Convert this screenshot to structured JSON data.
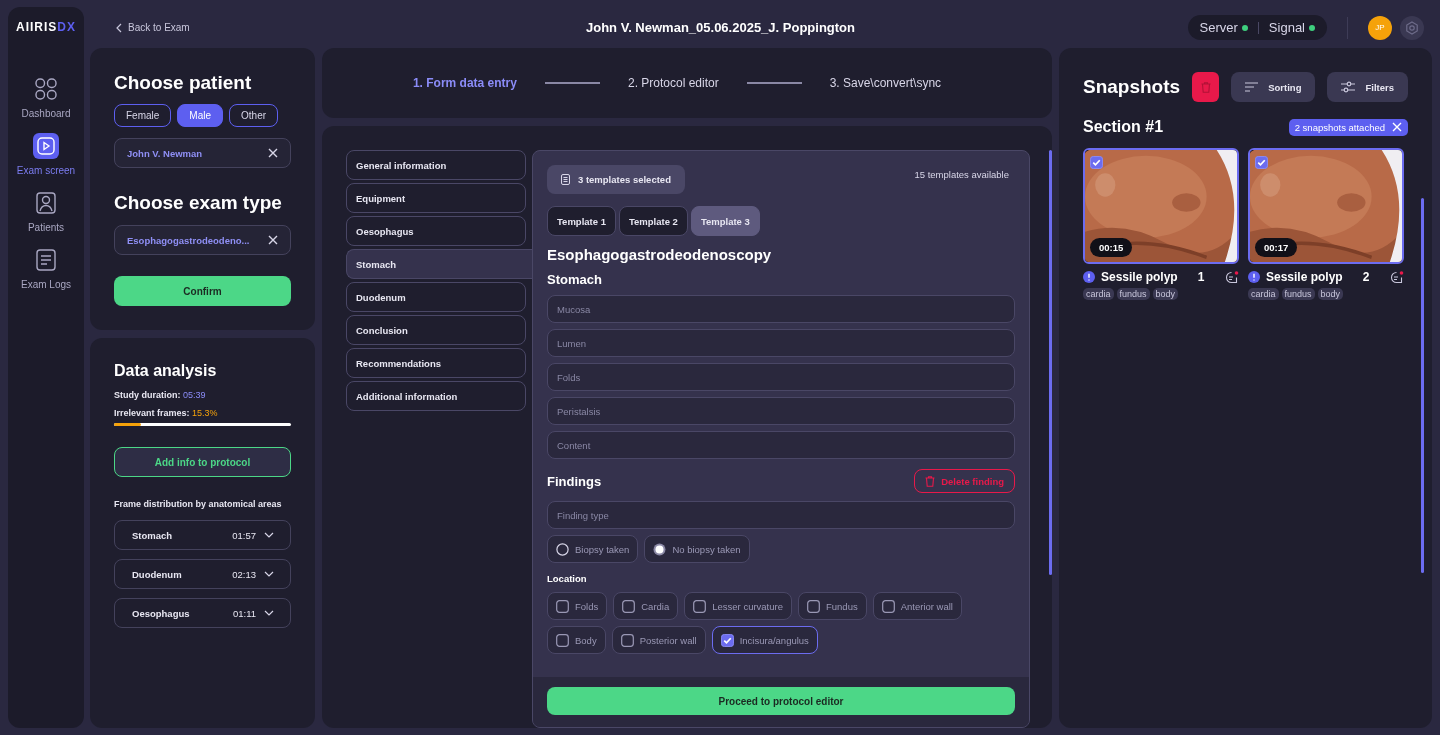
{
  "app": {
    "logo_primary": "AIIRIS",
    "logo_accent": "DX"
  },
  "nav": [
    {
      "label": "Dashboard",
      "selected": false
    },
    {
      "label": "Exam screen",
      "selected": true
    },
    {
      "label": "Patients",
      "selected": false
    },
    {
      "label": "Exam Logs",
      "selected": false
    }
  ],
  "header": {
    "back": "Back to Exam",
    "title": "John V. Newman_05.06.2025_J. Poppington",
    "status": [
      {
        "label": "Server",
        "online": true
      },
      {
        "label": "Signal",
        "online": true
      }
    ],
    "avatar": "JP"
  },
  "patient": {
    "title": "Choose patient",
    "genders": [
      {
        "label": "Female",
        "selected": false
      },
      {
        "label": "Male",
        "selected": true
      },
      {
        "label": "Other",
        "selected": false
      }
    ],
    "patient_value": "John V. Newman",
    "exam_title": "Choose exam type",
    "exam_value": "Esophagogastrodeodeno...",
    "confirm": "Confirm"
  },
  "analysis": {
    "title": "Data analysis",
    "duration_label": "Study duration:",
    "duration": "05:39",
    "irrelevant_label": "Irrelevant frames:",
    "irrelevant": "15.3%",
    "level": 0.153,
    "add_button": "Add info to protocol",
    "distribution_title": "Frame distribution by anatomical areas",
    "areas": [
      {
        "name": "Stomach",
        "time": "01:57",
        "expanded": false
      },
      {
        "name": "Duodenum",
        "time": "02:13",
        "expanded": false
      },
      {
        "name": "Oesophagus",
        "time": "01:11",
        "expanded": false
      }
    ]
  },
  "stepper": [
    {
      "label": "1. Form data entry",
      "selected": true
    },
    {
      "label": "2. Protocol editor",
      "selected": false
    },
    {
      "label": "3. Save\\convert\\sync",
      "selected": false
    }
  ],
  "form": {
    "sections": [
      {
        "label": "General information",
        "selected": false
      },
      {
        "label": "Equipment",
        "selected": false
      },
      {
        "label": "Oesophagus",
        "selected": false
      },
      {
        "label": "Stomach",
        "selected": true
      },
      {
        "label": "Duodenum",
        "selected": false
      },
      {
        "label": "Conclusion",
        "selected": false
      },
      {
        "label": "Recommendations",
        "selected": false
      },
      {
        "label": "Additional information",
        "selected": false
      }
    ],
    "templates_selected": "3 templates selected",
    "templates_available": "15 templates available",
    "template_tabs": [
      {
        "label": "Template 1",
        "selected": false
      },
      {
        "label": "Template 2",
        "selected": false
      },
      {
        "label": "Template 3",
        "selected": true
      }
    ],
    "heading": "Esophagogastrodeodenoscopy",
    "subheading": "Stomach",
    "fields": [
      {
        "placeholder": "Mucosa"
      },
      {
        "placeholder": "Lumen"
      },
      {
        "placeholder": "Folds"
      },
      {
        "placeholder": "Peristalsis"
      },
      {
        "placeholder": "Content"
      }
    ],
    "findings_title": "Findings",
    "delete_button": "Delete finding",
    "finding_type": {
      "placeholder": "Finding type"
    },
    "biopsy": [
      {
        "label": "Biopsy taken",
        "selected": false
      },
      {
        "label": "No biopsy taken",
        "selected": true
      }
    ],
    "location_title": "Location",
    "locations": [
      {
        "label": "Folds",
        "checked": false
      },
      {
        "label": "Cardia",
        "checked": false
      },
      {
        "label": "Lesser curvature",
        "checked": false
      },
      {
        "label": "Fundus",
        "checked": false
      },
      {
        "label": "Anterior wall",
        "checked": false
      },
      {
        "label": "Body",
        "checked": false
      },
      {
        "label": "Posterior wall",
        "checked": false
      },
      {
        "label": "Incisura/angulus",
        "checked": true
      }
    ],
    "proceed": "Proceed to protocol editor"
  },
  "snapshots": {
    "title": "Snapshots",
    "sorting": "Sorting",
    "filters": "Filters",
    "section": "Section #1",
    "attached": "2 snapshots attached",
    "items": [
      {
        "checked": true,
        "time": "00:15",
        "title": "Sessile polyp",
        "number": "1",
        "tags": [
          "cardia",
          "fundus",
          "body"
        ]
      },
      {
        "checked": true,
        "time": "00:17",
        "title": "Sessile polyp",
        "number": "2",
        "tags": [
          "cardia",
          "fundus",
          "body"
        ]
      }
    ]
  }
}
